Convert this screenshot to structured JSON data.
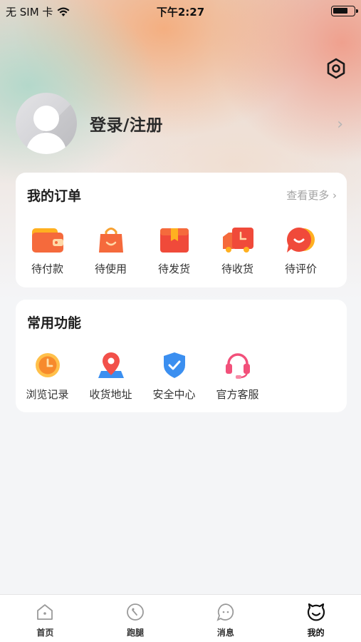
{
  "status_bar": {
    "carrier": "无 SIM 卡",
    "time": "下午2:27"
  },
  "profile": {
    "login_label": "登录/注册"
  },
  "orders": {
    "title": "我的订单",
    "more_label": "查看更多 ›",
    "items": [
      {
        "label": "待付款",
        "icon": "wallet-icon"
      },
      {
        "label": "待使用",
        "icon": "shopping-bag-icon"
      },
      {
        "label": "待发货",
        "icon": "package-box-icon"
      },
      {
        "label": "待收货",
        "icon": "delivery-truck-icon"
      },
      {
        "label": "待评价",
        "icon": "comment-bubble-icon"
      }
    ]
  },
  "functions": {
    "title": "常用功能",
    "items": [
      {
        "label": "浏览记录",
        "icon": "clock-icon"
      },
      {
        "label": "收货地址",
        "icon": "location-pin-icon"
      },
      {
        "label": "安全中心",
        "icon": "shield-check-icon"
      },
      {
        "label": "官方客服",
        "icon": "headset-icon"
      }
    ]
  },
  "tab_bar": {
    "items": [
      {
        "label": "首页",
        "icon": "home-icon",
        "active": false
      },
      {
        "label": "跑腿",
        "icon": "errand-icon",
        "active": false
      },
      {
        "label": "消息",
        "icon": "message-icon",
        "active": false
      },
      {
        "label": "我的",
        "icon": "mine-face-icon",
        "active": true
      }
    ]
  },
  "colors": {
    "accent_orange": "#f56a3c",
    "accent_red": "#f04a3a",
    "accent_blue": "#3b8ff0",
    "accent_pink": "#f2507a"
  }
}
